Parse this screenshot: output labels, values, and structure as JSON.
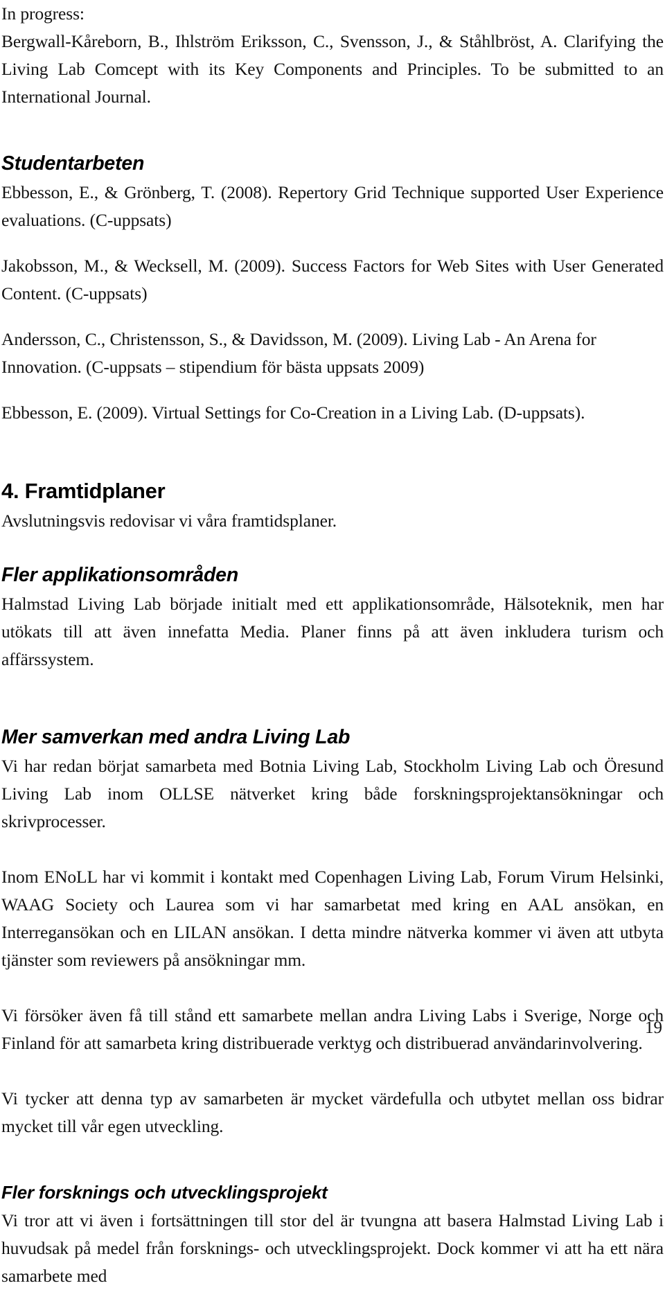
{
  "document": {
    "page_number": "19",
    "language": "sv-SE"
  },
  "sections": {
    "in_progress": {
      "label": "In progress:",
      "reference": "Bergwall-Kåreborn, B., Ihlström Eriksson, C., Svensson, J., & Ståhlbröst, A. Clarifying the Living Lab Comcept with its Key Components and Principles. To be submitted to an International Journal."
    },
    "studentarbeten": {
      "heading": "Studentarbeten",
      "references": [
        "Ebbesson, E., & Grönberg, T. (2008). Repertory Grid Technique supported User Experience evaluations. (C-uppsats)",
        "Jakobsson, M., & Wecksell, M. (2009). Success Factors for Web Sites with User Generated Content. (C-uppsats)",
        "Andersson, C., Christensson, S., & Davidsson, M. (2009). Living Lab - An Arena for Innovation. (C-uppsats – stipendium för bästa uppsats 2009)",
        "Ebbesson, E. (2009). Virtual Settings for Co-Creation in a Living Lab. (D-uppsats)."
      ]
    },
    "framtidplaner": {
      "heading": "4. Framtidplaner",
      "intro": "Avslutningsvis redovisar vi våra framtidsplaner.",
      "subsections": [
        {
          "heading": "Fler applikationsområden",
          "paragraphs": [
            "Halmstad Living Lab började initialt med ett applikationsområde, Hälsoteknik, men har utökats till att även innefatta Media. Planer finns på att även inkludera turism och affärssystem."
          ]
        },
        {
          "heading": "Mer samverkan med andra Living Lab",
          "paragraphs": [
            "Vi har redan börjat samarbeta med Botnia Living Lab, Stockholm Living Lab och Öresund Living Lab inom OLLSE nätverket kring både forskningsprojektansökningar och skrivprocesser.",
            "Inom ENoLL har vi kommit i kontakt med Copenhagen Living Lab, Forum Virum Helsinki, WAAG Society och Laurea som vi har samarbetat med kring en AAL ansökan, en Interregansökan och en LILAN ansökan. I detta mindre nätverka kommer vi även att utbyta tjänster som reviewers på ansökningar mm.",
            "Vi försöker även få till stånd ett samarbete mellan andra Living Labs i Sverige, Norge och Finland för att samarbeta kring distribuerade verktyg och distribuerad användarinvolvering.",
            "Vi tycker att denna typ av samarbeten är mycket värdefulla och utbytet mellan oss bidrar mycket till vår egen utveckling."
          ]
        },
        {
          "heading": "Fler forsknings och utvecklingsprojekt",
          "paragraphs": [
            "Vi tror att vi även i fortsättningen till stor del är tvungna att basera Halmstad Living Lab i huvudsak på medel från forsknings- och utvecklingsprojekt. Dock kommer vi att ha ett nära samarbete med"
          ]
        }
      ]
    }
  }
}
